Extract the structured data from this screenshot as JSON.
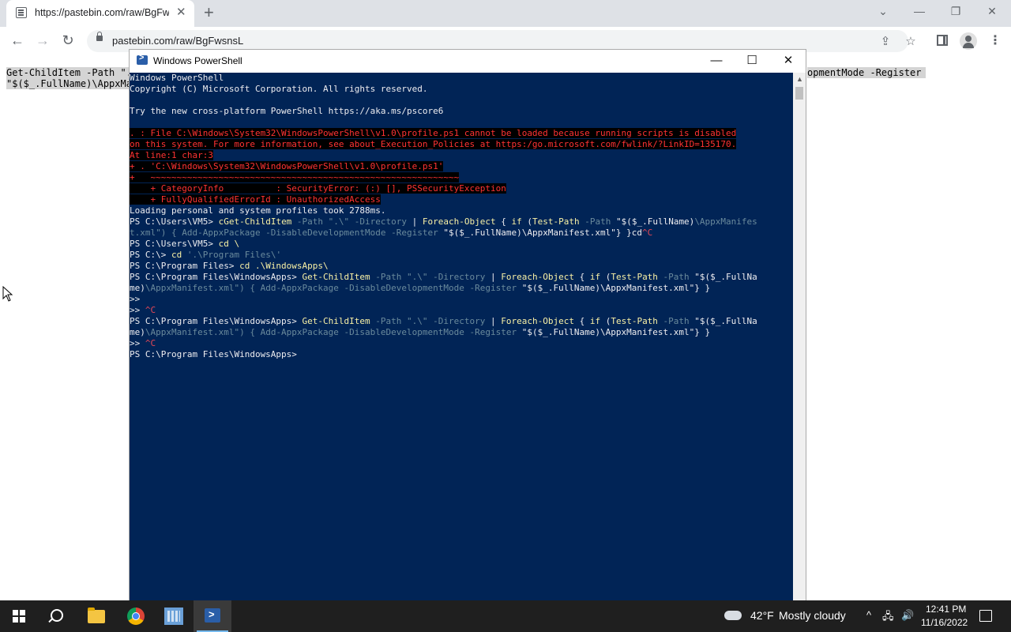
{
  "browser": {
    "tab_title": "https://pastebin.com/raw/BgFwsnsL",
    "tab_close": "✕",
    "new_tab": "+",
    "url": "pastebin.com/raw/BgFwsnsL",
    "window_controls": {
      "chevron": "⌄",
      "minimize": "—",
      "restore": "❐",
      "close": "✕"
    },
    "nav": {
      "back": "←",
      "forward": "→",
      "reload": "↻"
    },
    "toolbar_icons": {
      "share": "⇪",
      "star": "☆",
      "menu": "⋮"
    }
  },
  "page": {
    "raw_line1_left": "Get-ChildItem -Path \".",
    "raw_line2_left": "\"$($_.FullName)\\AppxMa",
    "raw_line1_right": "opmentMode -Register "
  },
  "powershell": {
    "title": "Windows PowerShell",
    "controls": {
      "minimize": "—",
      "maximize": "☐",
      "close": "✕"
    },
    "scroll_up": "▲",
    "lines": [
      [
        {
          "t": "Windows PowerShell",
          "c": "w"
        }
      ],
      [
        {
          "t": "Copyright (C) Microsoft Corporation. All rights reserved.",
          "c": "w"
        }
      ],
      [
        {
          "t": "",
          "c": "w"
        }
      ],
      [
        {
          "t": "Try the new cross-platform PowerShell https://aka.ms/pscore6",
          "c": "w"
        }
      ],
      [
        {
          "t": "",
          "c": "w"
        }
      ],
      [
        {
          "t": ". : File C:\\Windows\\System32\\WindowsPowerShell\\v1.0\\profile.ps1 cannot be loaded because running scripts is disabled",
          "c": "err"
        }
      ],
      [
        {
          "t": "on this system. For more information, see about_Execution_Policies at https:/go.microsoft.com/fwlink/?LinkID=135170.",
          "c": "err"
        }
      ],
      [
        {
          "t": "At line:1 char:3",
          "c": "err"
        }
      ],
      [
        {
          "t": "+ . 'C:\\Windows\\System32\\WindowsPowerShell\\v1.0\\profile.ps1'",
          "c": "err"
        }
      ],
      [
        {
          "t": "+   ~~~~~~~~~~~~~~~~~~~~~~~~~~~~~~~~~~~~~~~~~~~~~~~~~~~~~~~~~~~",
          "c": "err"
        }
      ],
      [
        {
          "t": "    + CategoryInfo          : SecurityError: (:) [], PSSecurityException",
          "c": "err"
        }
      ],
      [
        {
          "t": "    + FullyQualifiedErrorId : UnauthorizedAccess",
          "c": "err"
        }
      ],
      [
        {
          "t": "Loading personal and system profiles took 2788ms.",
          "c": "w"
        }
      ],
      [
        {
          "t": "PS C:\\Users\\VM5> ",
          "c": "w"
        },
        {
          "t": "cGet-ChildItem",
          "c": "y"
        },
        {
          "t": " -Path ",
          "c": "g"
        },
        {
          "t": "\".\\\"",
          "c": "g"
        },
        {
          "t": " -Directory ",
          "c": "g"
        },
        {
          "t": "| ",
          "c": "w"
        },
        {
          "t": "Foreach-Object",
          "c": "y"
        },
        {
          "t": " { ",
          "c": "w"
        },
        {
          "t": "if",
          "c": "y"
        },
        {
          "t": " (",
          "c": "w"
        },
        {
          "t": "Test-Path",
          "c": "y"
        },
        {
          "t": " -Path ",
          "c": "g"
        },
        {
          "t": "\"$($_.FullName)",
          "c": "w"
        },
        {
          "t": "\\AppxManifes",
          "c": "g"
        }
      ],
      [
        {
          "t": "t.xml\") { Add-AppxPackage -DisableDevelopmentMode -Register ",
          "c": "g"
        },
        {
          "t": "\"$($_.FullName)\\AppxManifest.xml\"} }cd",
          "c": "w"
        },
        {
          "t": "^C",
          "c": "r"
        }
      ],
      [
        {
          "t": "PS C:\\Users\\VM5> ",
          "c": "w"
        },
        {
          "t": "cd \\",
          "c": "y"
        }
      ],
      [
        {
          "t": "PS C:\\> ",
          "c": "w"
        },
        {
          "t": "cd",
          "c": "y"
        },
        {
          "t": " '.\\Program Files\\'",
          "c": "g"
        }
      ],
      [
        {
          "t": "PS C:\\Program Files> ",
          "c": "w"
        },
        {
          "t": "cd .\\WindowsApps\\",
          "c": "y"
        }
      ],
      [
        {
          "t": "PS C:\\Program Files\\WindowsApps> ",
          "c": "w"
        },
        {
          "t": "Get-ChildItem",
          "c": "y"
        },
        {
          "t": " -Path ",
          "c": "g"
        },
        {
          "t": "\".\\\"",
          "c": "g"
        },
        {
          "t": " -Directory ",
          "c": "g"
        },
        {
          "t": "| ",
          "c": "w"
        },
        {
          "t": "Foreach-Object",
          "c": "y"
        },
        {
          "t": " { ",
          "c": "w"
        },
        {
          "t": "if",
          "c": "y"
        },
        {
          "t": " (",
          "c": "w"
        },
        {
          "t": "Test-Path",
          "c": "y"
        },
        {
          "t": " -Path ",
          "c": "g"
        },
        {
          "t": "\"$($_.FullNa",
          "c": "w"
        }
      ],
      [
        {
          "t": "me)",
          "c": "w"
        },
        {
          "t": "\\AppxManifest.xml\") { Add-AppxPackage -DisableDevelopmentMode -Register ",
          "c": "g"
        },
        {
          "t": "\"$($_.FullName)\\AppxManifest.xml\"} }",
          "c": "w"
        }
      ],
      [
        {
          "t": ">> ",
          "c": "w"
        }
      ],
      [
        {
          "t": ">> ",
          "c": "w"
        },
        {
          "t": "^C",
          "c": "r"
        }
      ],
      [
        {
          "t": "PS C:\\Program Files\\WindowsApps> ",
          "c": "w"
        },
        {
          "t": "Get-ChildItem",
          "c": "y"
        },
        {
          "t": " -Path ",
          "c": "g"
        },
        {
          "t": "\".\\\"",
          "c": "g"
        },
        {
          "t": " -Directory ",
          "c": "g"
        },
        {
          "t": "| ",
          "c": "w"
        },
        {
          "t": "Foreach-Object",
          "c": "y"
        },
        {
          "t": " { ",
          "c": "w"
        },
        {
          "t": "if",
          "c": "y"
        },
        {
          "t": " (",
          "c": "w"
        },
        {
          "t": "Test-Path",
          "c": "y"
        },
        {
          "t": " -Path ",
          "c": "g"
        },
        {
          "t": "\"$($_.FullNa",
          "c": "w"
        }
      ],
      [
        {
          "t": "me)",
          "c": "w"
        },
        {
          "t": "\\AppxManifest.xml\") { Add-AppxPackage -DisableDevelopmentMode -Register ",
          "c": "g"
        },
        {
          "t": "\"$($_.FullName)\\AppxManifest.xml\"} }",
          "c": "w"
        }
      ],
      [
        {
          "t": ">> ",
          "c": "w"
        },
        {
          "t": "^C",
          "c": "r"
        }
      ],
      [
        {
          "t": "PS C:\\Program Files\\WindowsApps> ",
          "c": "w"
        }
      ]
    ]
  },
  "taskbar": {
    "weather_temp": "42°F",
    "weather_desc": "Mostly cloudy",
    "tray_chevron": "^",
    "tray_network": "🖧",
    "tray_volume": "🔊",
    "time": "12:41 PM",
    "date": "11/16/2022"
  }
}
